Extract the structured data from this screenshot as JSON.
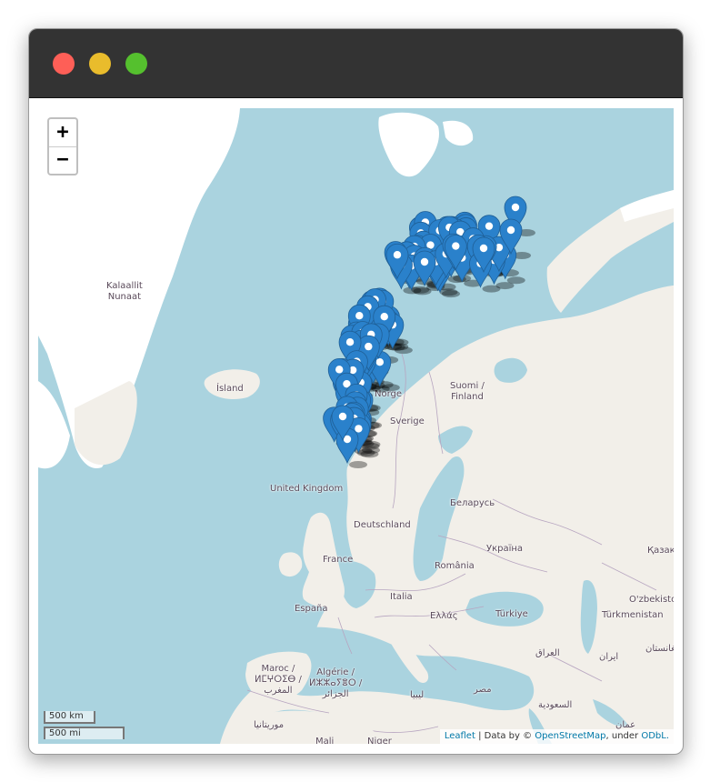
{
  "window": {
    "controls": [
      "close",
      "minimize",
      "maximize"
    ]
  },
  "map": {
    "zoom_in_label": "+",
    "zoom_out_label": "−",
    "labels": {
      "greenland": "Kalaallit\nNunaat",
      "iceland": "Ísland",
      "norway": "Norge",
      "sweden": "Sverige",
      "finland": "Suomi /\nFinland",
      "uk": "United Kingdom",
      "germany": "Deutschland",
      "belarus": "Беларусь",
      "ukraine": "Україна",
      "kazakhstan": "Қазақ",
      "france": "France",
      "romania": "România",
      "italy": "Italia",
      "spain": "España",
      "greece": "Ελλάς",
      "turkey": "Türkiye",
      "uzbekistan": "O'zbekiston",
      "turkmenistan": "Türkmenistan",
      "morocco": "Maroc /\nⵍⵎⵖⵔⵉⴱ /\nالمغرب",
      "algeria": "Algérie /\nⵍⵣⵣⴰⵢⴻⵔ /\nالجزائر",
      "iraq": "العراق",
      "iran": "ایران",
      "afghanistan": "افغانستان",
      "libya": "ليبيا",
      "egypt": "مصر",
      "saudi": "السعودية",
      "mauritania": "موريتانيا",
      "mali": "Mali",
      "niger": "Niger",
      "oman": "عمان"
    },
    "scale": {
      "km": "500 km",
      "mi": "500 mi"
    },
    "attribution": {
      "leaflet": "Leaflet",
      "sep": " | Data by © ",
      "osm": "OpenStreetMap",
      "under": ", under ",
      "odbl": "ODbL."
    },
    "marker_icon": "map-pin-icon",
    "marker_color": "#2a81cb",
    "marker_shadow": "#000000",
    "land_color": "#f2efe9",
    "water_color": "#aad3df",
    "ice_color": "#ffffff"
  }
}
